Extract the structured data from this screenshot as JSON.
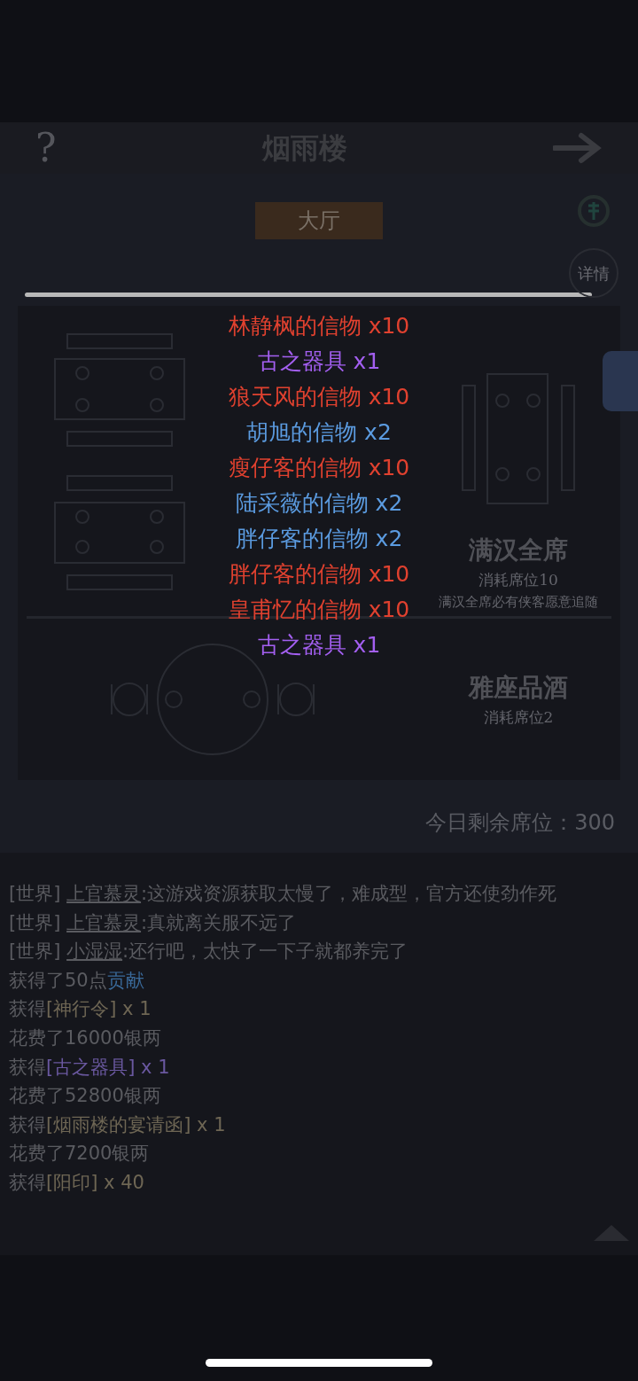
{
  "header": {
    "help": "?",
    "title": "烟雨楼"
  },
  "tabs": [
    {
      "label": "大厅",
      "selected": true
    }
  ],
  "side_buttons": [
    {
      "label": "详情"
    }
  ],
  "banquets": [
    {
      "title": "满汉全席",
      "cost": "消耗席位10",
      "description": "满汉全席必有侠客愿意追随"
    },
    {
      "title": "雅座品酒",
      "cost": "消耗席位2"
    }
  ],
  "seats_remaining": "今日剩余席位：300",
  "rewards": [
    {
      "text": "林静枫的信物 x10",
      "color": "#e0412f"
    },
    {
      "text": "古之器具 x1",
      "color": "#a35ff0"
    },
    {
      "text": "狼天风的信物 x10",
      "color": "#e0412f"
    },
    {
      "text": "胡旭的信物 x2",
      "color": "#5b9be0"
    },
    {
      "text": "瘦仔客的信物 x10",
      "color": "#e0412f"
    },
    {
      "text": "陆采薇的信物 x2",
      "color": "#5b9be0"
    },
    {
      "text": "胖仔客的信物 x2",
      "color": "#5b9be0"
    },
    {
      "text": "胖仔客的信物 x10",
      "color": "#e0412f"
    },
    {
      "text": "皇甫忆的信物 x10",
      "color": "#e0412f"
    },
    {
      "text": "古之器具 x1",
      "color": "#a35ff0"
    }
  ],
  "chat": [
    [
      {
        "kind": "plain",
        "text": "[世界] "
      },
      {
        "kind": "name",
        "text": "上官慕灵"
      },
      {
        "kind": "plain",
        "text": ":这游戏资源获取太慢了，难成型，官方还使劲作死"
      }
    ],
    [
      {
        "kind": "plain",
        "text": "[世界] "
      },
      {
        "kind": "name",
        "text": "上官慕灵"
      },
      {
        "kind": "plain",
        "text": ":真就离关服不远了"
      }
    ],
    [
      {
        "kind": "plain",
        "text": "[世界] "
      },
      {
        "kind": "name",
        "text": "小湿湿"
      },
      {
        "kind": "plain",
        "text": ":还行吧，太快了一下子就都养完了"
      }
    ],
    [
      {
        "kind": "plain",
        "text": "获得了50点"
      },
      {
        "kind": "link",
        "text": "贡献",
        "color": "#3a6a9a"
      }
    ],
    [
      {
        "kind": "plain",
        "text": "获得"
      },
      {
        "kind": "link",
        "text": "[神行令] x 1",
        "color": "#6e6654"
      }
    ],
    [
      {
        "kind": "plain",
        "text": "花费了16000银两"
      }
    ],
    [
      {
        "kind": "plain",
        "text": "获得"
      },
      {
        "kind": "link",
        "text": "[古之器具] x 1",
        "color": "#6a58a0"
      }
    ],
    [
      {
        "kind": "plain",
        "text": "花费了52800银两"
      }
    ],
    [
      {
        "kind": "plain",
        "text": "获得"
      },
      {
        "kind": "link",
        "text": "[烟雨楼的宴请函] x 1",
        "color": "#6e6654"
      }
    ],
    [
      {
        "kind": "plain",
        "text": "花费了7200银两"
      }
    ],
    [
      {
        "kind": "plain",
        "text": "获得"
      },
      {
        "kind": "link",
        "text": "[阳印] x 40",
        "color": "#6e6654"
      }
    ]
  ]
}
